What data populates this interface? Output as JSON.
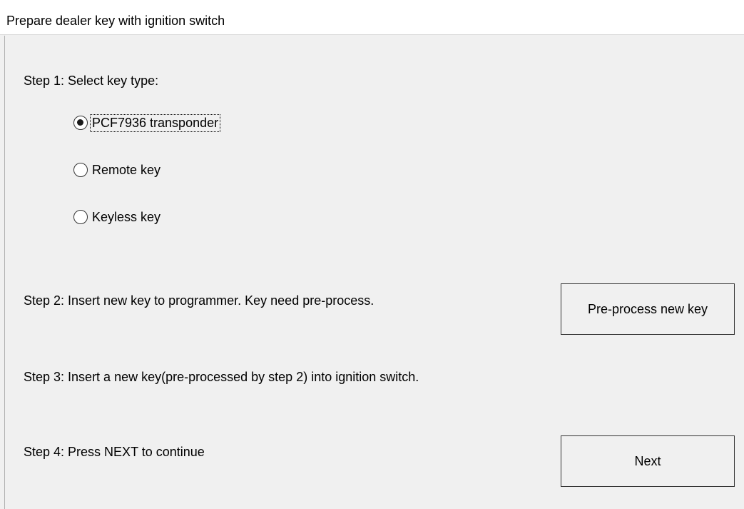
{
  "window": {
    "title": "Prepare dealer key with ignition switch"
  },
  "step1": {
    "label": "Step 1: Select key type:",
    "options": [
      {
        "label": "PCF7936 transponder",
        "selected": true
      },
      {
        "label": "Remote key",
        "selected": false
      },
      {
        "label": "Keyless key",
        "selected": false
      }
    ]
  },
  "step2": {
    "label": "Step 2: Insert new key to programmer. Key need pre-process.",
    "button_label": "Pre-process new key"
  },
  "step3": {
    "label": "Step 3: Insert a new key(pre-processed by step 2) into ignition switch."
  },
  "step4": {
    "label": "Step 4: Press NEXT to continue",
    "button_label": "Next"
  }
}
